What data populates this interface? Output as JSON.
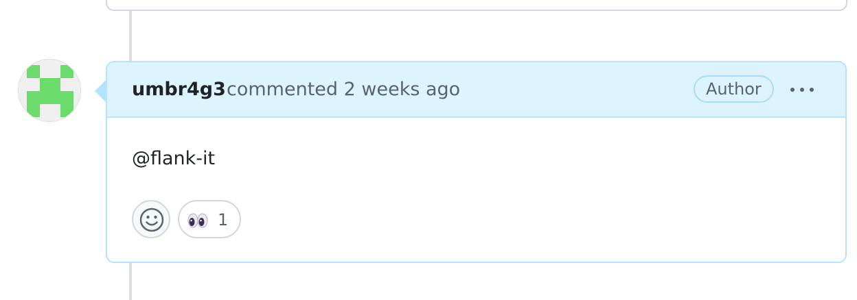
{
  "comment": {
    "author": "umbr4g3",
    "action": "commented",
    "time": "2 weeks ago",
    "badge": "Author",
    "body": "@flank-it"
  },
  "reactions": [
    {
      "icon": "eyes-emoji",
      "count": "1"
    }
  ],
  "icons": {
    "avatar": "identicon-avatar",
    "menu": "kebab-horizontal-icon",
    "add_reaction": "smiley-icon"
  },
  "colors": {
    "header_bg": "#ddf4ff",
    "header_border": "#b6e3ff",
    "identicon": "#6bdc6b",
    "timeline": "#d8dee4"
  }
}
